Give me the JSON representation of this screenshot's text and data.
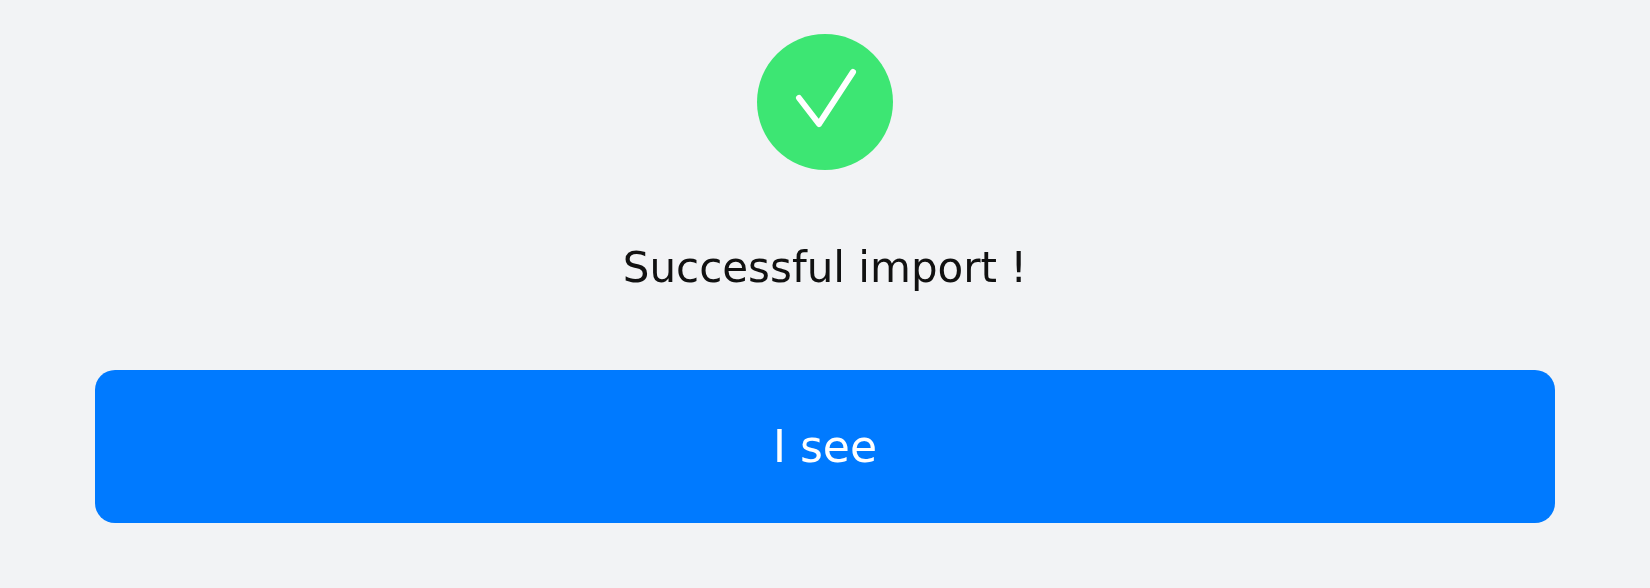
{
  "message": "Successful import !",
  "button": {
    "label": "I see"
  }
}
